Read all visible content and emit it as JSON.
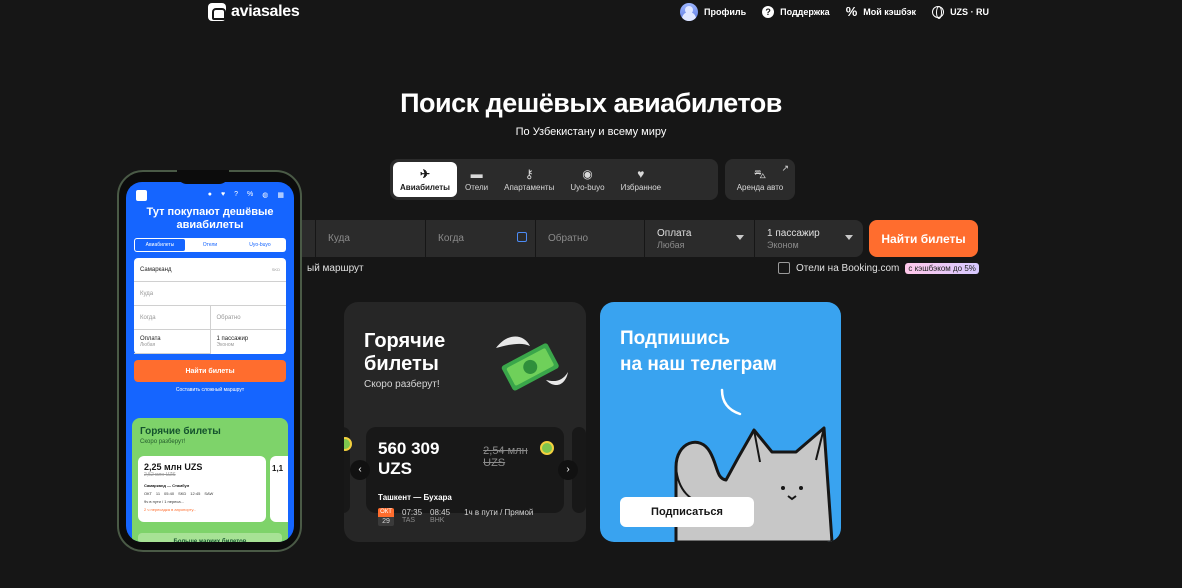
{
  "header": {
    "logo": "aviasales",
    "nav": {
      "profile": "Профиль",
      "support": "Поддержка",
      "cashback": "Мой кэшбэк",
      "currency_lang": "UZS · RU"
    }
  },
  "hero": {
    "title": "Поиск дешёвых авиабилетов",
    "subtitle": "По Узбекистану и всему миру"
  },
  "tabs": [
    {
      "label": "Авиабилеты",
      "icon": "airplane-icon",
      "active": true
    },
    {
      "label": "Отели",
      "icon": "bed-icon",
      "active": false
    },
    {
      "label": "Апартаменты",
      "icon": "key-icon",
      "active": false
    },
    {
      "label": "Uyo-buyo",
      "icon": "pin-icon",
      "active": false
    },
    {
      "label": "Избранное",
      "icon": "heart-icon",
      "active": false
    }
  ],
  "car_rent": {
    "label": "Аренда авто",
    "icon": "car-icon"
  },
  "search": {
    "to_placeholder": "Куда",
    "depart_placeholder": "Когда",
    "return_placeholder": "Обратно",
    "payment_label": "Оплата",
    "payment_value": "Любая",
    "passengers_label": "1 пассажир",
    "passengers_class": "Эконом",
    "find_button": "Найти билеты",
    "route_link": "ый маршрут",
    "booking_label": "Отели на Booking.com",
    "booking_badge": "с кэшбэком до 5%"
  },
  "hot_tickets": {
    "title_line1": "Горячие",
    "title_line2": "билеты",
    "subtitle": "Скоро разберут!",
    "ticket": {
      "price": "560 309 UZS",
      "old_price": "2,54 млн UZS",
      "route": "Ташкент — Бухара",
      "month": "ОКТ",
      "day": "29",
      "depart_time": "07:35",
      "depart_code": "TAS",
      "arrive_time": "08:45",
      "arrive_code": "BHK",
      "duration": "1ч в пути / Прямой"
    },
    "prev_arrow": "‹",
    "next_arrow": "›"
  },
  "telegram": {
    "title_line1": "Подпишись",
    "title_line2": "на наш телеграм",
    "button": "Подписаться"
  },
  "phone": {
    "title_line1": "Тут покупают дешёвые",
    "title_line2": "авиабилеты",
    "tabs": [
      "Авиабилеты",
      "Отели",
      "Uyo-buyo"
    ],
    "from_value": "Самарканд",
    "from_code": "SKD",
    "to_placeholder": "Куда",
    "depart_placeholder": "Когда",
    "return_placeholder": "Обратно",
    "payment_label": "Оплата",
    "payment_value": "Любая",
    "passengers_label": "1 пассажир",
    "passengers_class": "Эконом",
    "find_button": "Найти билеты",
    "route_link": "Составить сложный маршрут",
    "hot_title": "Горячие билеты",
    "hot_sub": "Скоро разберут!",
    "ticket_price": "2,25 млн UZS",
    "ticket_old": "2,52 млн UZS",
    "ticket_route": "Самарканд — Стамбул",
    "ticket_month": "ОКТ",
    "ticket_day": "11",
    "ticket_dep": "05:40",
    "ticket_dep_code": "SKD",
    "ticket_arr": "12:45",
    "ticket_arr_code": "SAW",
    "ticket_dur": "9ч в пути / 1 переса...",
    "ticket_note": "2 ч пересадка в аэропорту...",
    "next_price": "1,1",
    "more_button": "Больше жарких билетов"
  }
}
